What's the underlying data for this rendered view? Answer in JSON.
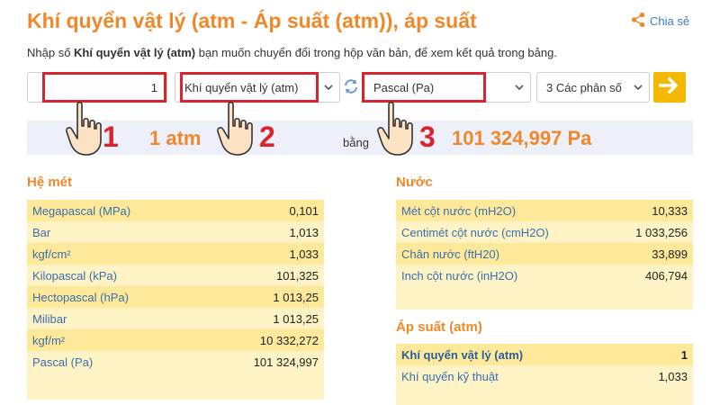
{
  "header": {
    "title": "Khí quyển vật lý (atm - Áp suất (atm)), áp suất",
    "share_label": "Chia sẻ",
    "intro_prefix": "Nhập số ",
    "intro_bold": "Khí quyển vật lý (atm)",
    "intro_suffix": " bạn muốn chuyển đổi trong hộp văn bản, để xem kết quả trong bảng."
  },
  "converter": {
    "input_value": "1",
    "from_unit": "Khí quyển vật lý (atm)",
    "to_unit": "Pascal (Pa)",
    "decimals": "3 Các phân số"
  },
  "result": {
    "from_text": "1 atm",
    "equals_text": "bằng",
    "to_text": "101 324,997 Pa"
  },
  "annotations": {
    "step1": "1",
    "step2": "2",
    "step3": "3"
  },
  "metric": {
    "title": "Hệ mét",
    "rows": [
      {
        "name": "Megapascal (MPa)",
        "value": "0,101"
      },
      {
        "name": "Bar",
        "value": "1,013"
      },
      {
        "name": "kgf/cm²",
        "value": "1,033"
      },
      {
        "name": "Kilopascal (kPa)",
        "value": "101,325"
      },
      {
        "name": "Hectopascal (hPa)",
        "value": "1 013,25"
      },
      {
        "name": "Milibar",
        "value": "1 013,25"
      },
      {
        "name": "kgf/m²",
        "value": "10 332,272"
      },
      {
        "name": "Pascal (Pa)",
        "value": "101 324,997"
      }
    ]
  },
  "water": {
    "title": "Nước",
    "rows": [
      {
        "name": "Mét cột nước (mH2O)",
        "value": "10,333"
      },
      {
        "name": "Centimét cột nước (cmH2O)",
        "value": "1 033,256"
      },
      {
        "name": "Chân nước (ftH20)",
        "value": "33,899"
      },
      {
        "name": "Inch cột nước (inH2O)",
        "value": "406,794"
      }
    ]
  },
  "pressure": {
    "title": "Áp suất (atm)",
    "rows": [
      {
        "name": "Khí quyển vật lý (atm)",
        "value": "1"
      },
      {
        "name": "Khí quyển kỹ thuật",
        "value": "1,033"
      }
    ]
  },
  "colors": {
    "accent_orange": "#f0882a",
    "annotation_red": "#d9232e",
    "link_blue": "#3a7bc8",
    "row_dark": "#fde999",
    "row_light": "#fdf3c4",
    "button_yellow": "#f5b800"
  },
  "icons": {
    "share": "share-icon",
    "swap": "swap-arrows-icon",
    "go": "arrow-right-icon",
    "pointer": "pointing-hand-icon"
  }
}
